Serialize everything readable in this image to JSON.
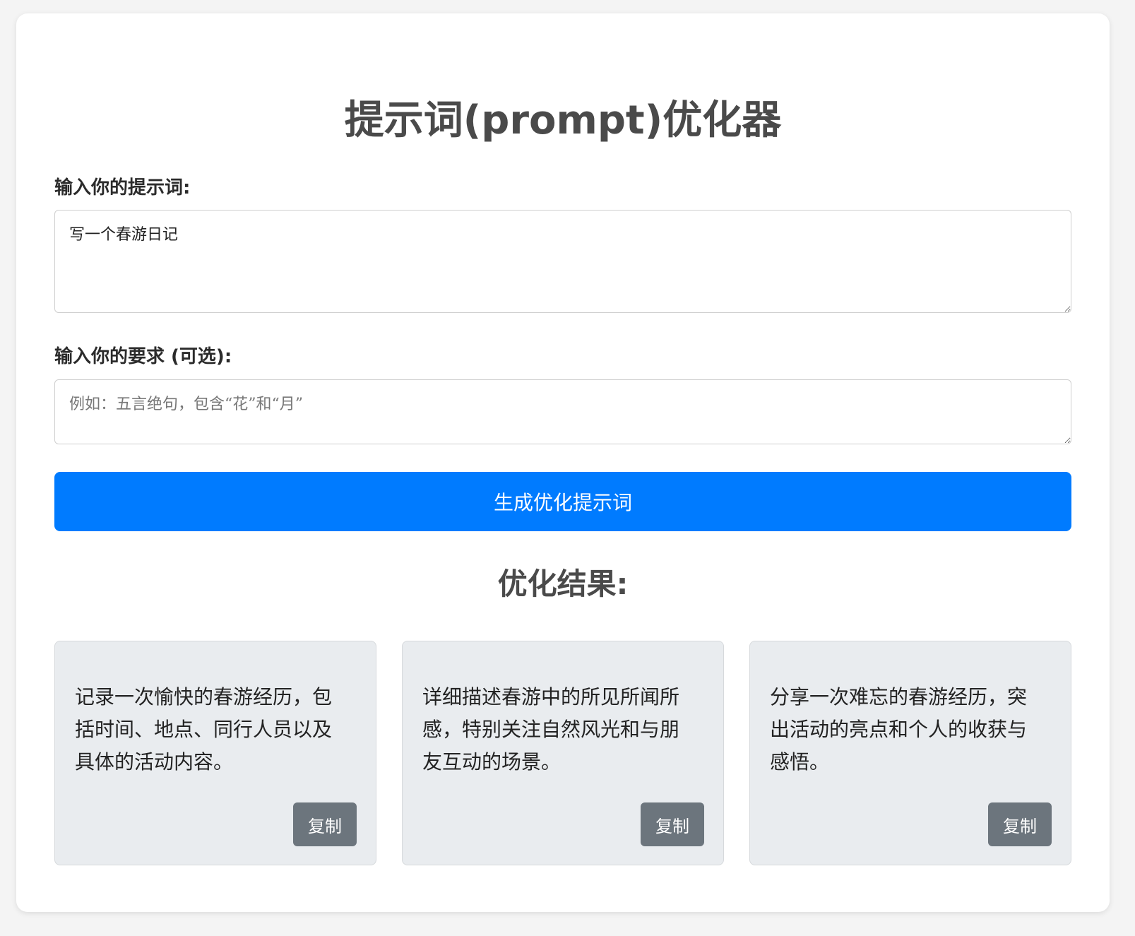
{
  "header": {
    "title": "提示词(prompt)优化器"
  },
  "form": {
    "prompt_label": "输入你的提示词:",
    "prompt_value": "写一个春游日记",
    "requirement_label": "输入你的要求 (可选):",
    "requirement_value": "",
    "requirement_placeholder": "例如：五言绝句，包含“花”和“月”",
    "generate_label": "生成优化提示词"
  },
  "results": {
    "title": "优化结果:",
    "items": [
      {
        "text": "记录一次愉快的春游经历，包括时间、地点、同行人员以及具体的活动内容。",
        "copy_label": "复制"
      },
      {
        "text": "详细描述春游中的所见所闻所感，特别关注自然风光和与朋友互动的场景。",
        "copy_label": "复制"
      },
      {
        "text": "分享一次难忘的春游经历，突出活动的亮点和个人的收获与感悟。",
        "copy_label": "复制"
      }
    ]
  },
  "colors": {
    "primary": "#007bff",
    "secondary": "#6c757d",
    "result_bg": "#e9ecef"
  }
}
